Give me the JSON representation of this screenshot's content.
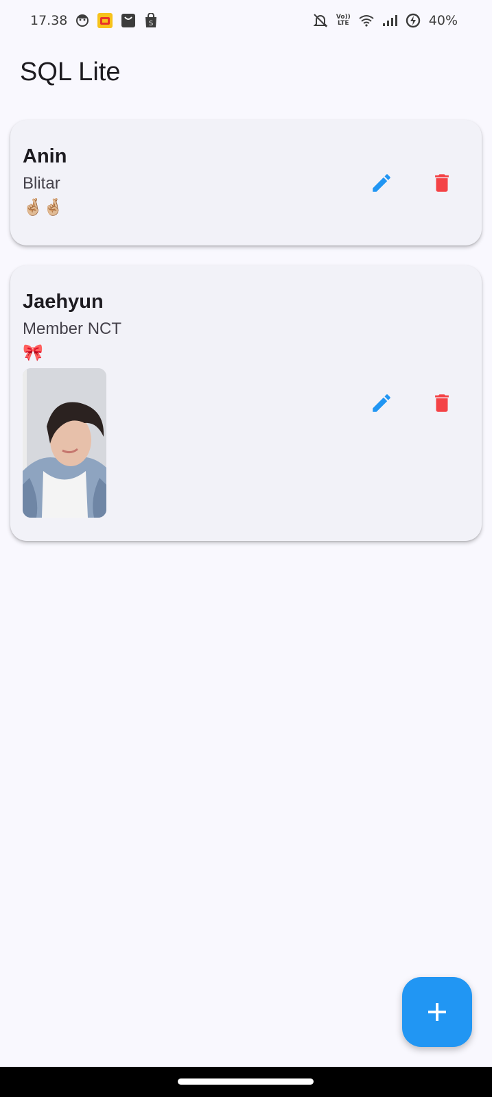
{
  "status_bar": {
    "time": "17.38",
    "battery": "40%",
    "volte_top": "Vo))",
    "volte_bottom": "LTE"
  },
  "app": {
    "title": "SQL Lite"
  },
  "items": [
    {
      "name": "Anin",
      "subtitle": "Blitar",
      "emoji": "🤞🏼🤞🏼",
      "has_photo": false
    },
    {
      "name": "Jaehyun",
      "subtitle": "Member NCT",
      "emoji": "🎀",
      "has_photo": true
    }
  ],
  "colors": {
    "accent": "#2196f3",
    "delete": "#f44346",
    "background": "#f9f8fe",
    "card": "#f2f2f8"
  },
  "icons": {
    "edit": "pencil-icon",
    "delete": "trash-icon",
    "add": "plus-icon"
  }
}
